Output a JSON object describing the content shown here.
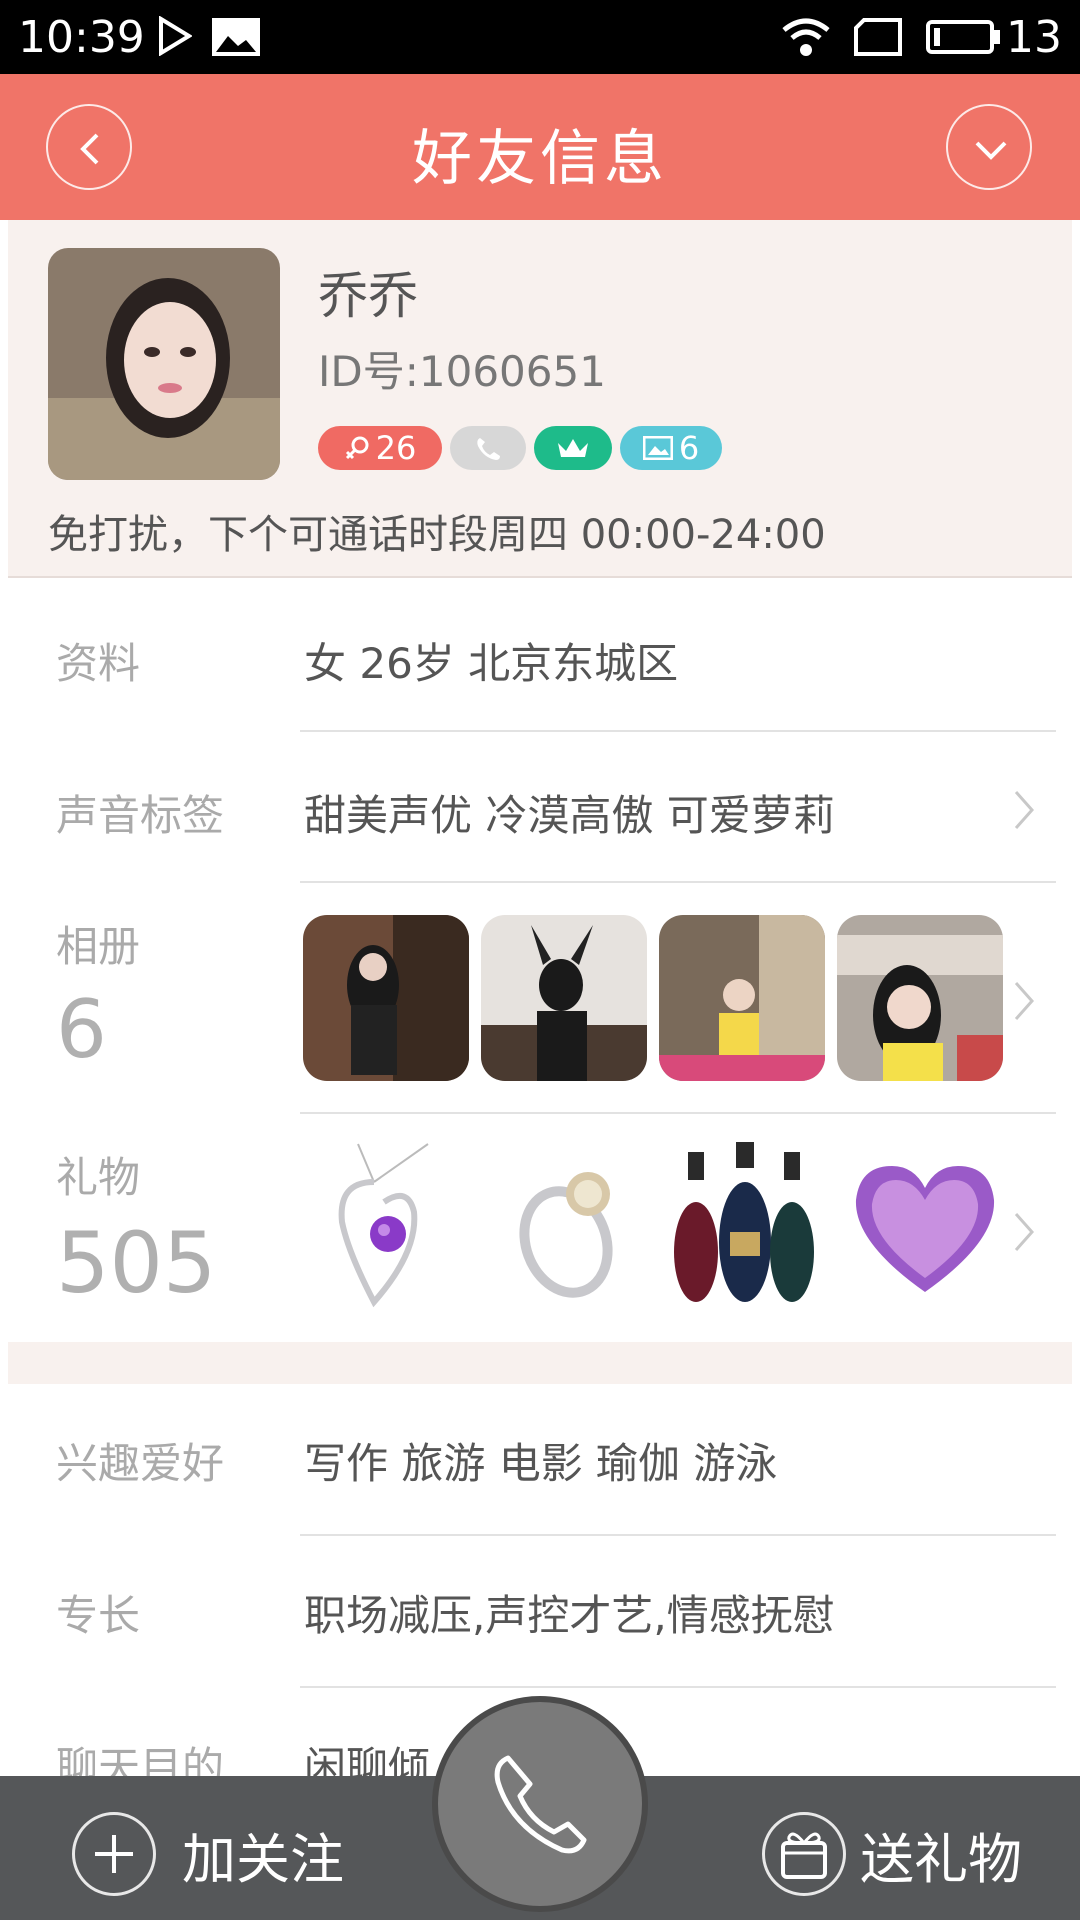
{
  "status_bar": {
    "time": "10:39",
    "battery": "13"
  },
  "header": {
    "title": "好友信息"
  },
  "profile": {
    "nickname": "乔乔",
    "id": "ID号:1060651",
    "badges": {
      "age": "26",
      "photos": "6"
    },
    "dnd_text": "免打扰，下个可通话时段周四 00:00-24:00"
  },
  "info": {
    "label": "资料",
    "value": "女  26岁   北京东城区"
  },
  "voice_tags": {
    "label": "声音标签",
    "value": "甜美声优  冷漠高傲  可爱萝莉"
  },
  "album": {
    "label": "相册",
    "count": "6"
  },
  "gifts": {
    "label": "礼物",
    "count": "505"
  },
  "hobbies": {
    "label": "兴趣爱好",
    "value": "写作 旅游 电影 瑜伽 游泳"
  },
  "specialty": {
    "label": "专长",
    "value": "职场减压,声控才艺,情感抚慰"
  },
  "chat_purpose": {
    "label": "聊天目的",
    "value": "闲聊倾"
  },
  "bottom_bar": {
    "follow_label": "加关注",
    "gift_label": "送礼物"
  },
  "colors": {
    "header": "#f07468",
    "badge_age": "#f06a63",
    "badge_phone": "#d7d7d7",
    "badge_crown": "#1ebb8a",
    "badge_photo": "#5ac8d8",
    "bottom_bar": "#555759"
  }
}
